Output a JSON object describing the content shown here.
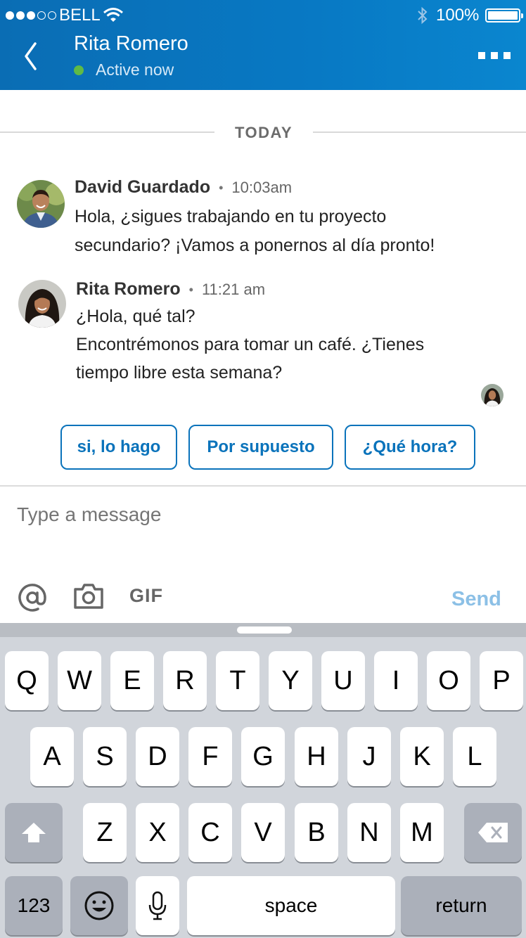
{
  "status_bar": {
    "carrier": "BELL",
    "battery": "100%"
  },
  "header": {
    "contact_name": "Rita Romero",
    "presence": "Active now"
  },
  "divider": {
    "label": "TODAY"
  },
  "messages": [
    {
      "sender": "David Guardado",
      "time": "10:03am",
      "lines": [
        "Hola, ¿sigues trabajando en tu proyecto",
        "secundario? ¡Vamos a ponernos al día pronto!"
      ]
    },
    {
      "sender": "Rita Romero",
      "time": "11:21 am",
      "lines": [
        "¿Hola, qué tal?",
        "Encontrémonos para tomar un café. ¿Tienes",
        "tiempo libre esta semana?"
      ]
    }
  ],
  "quick_replies": [
    "si, lo hago",
    "Por supuesto",
    "¿Qué hora?"
  ],
  "composer": {
    "placeholder": "Type a message",
    "gif_label": "GIF",
    "send_label": "Send"
  },
  "keyboard": {
    "row1": [
      "Q",
      "W",
      "E",
      "R",
      "T",
      "Y",
      "U",
      "I",
      "O",
      "P"
    ],
    "row2": [
      "A",
      "S",
      "D",
      "F",
      "G",
      "H",
      "J",
      "K",
      "L"
    ],
    "row3": [
      "Z",
      "X",
      "C",
      "V",
      "B",
      "N",
      "M"
    ],
    "numbers_label": "123",
    "space_label": "space",
    "return_label": "return"
  },
  "colors": {
    "header": "#0879c4",
    "accent": "#0a73bb",
    "presence": "#5fba46",
    "send_disabled": "#8cc0e6"
  }
}
